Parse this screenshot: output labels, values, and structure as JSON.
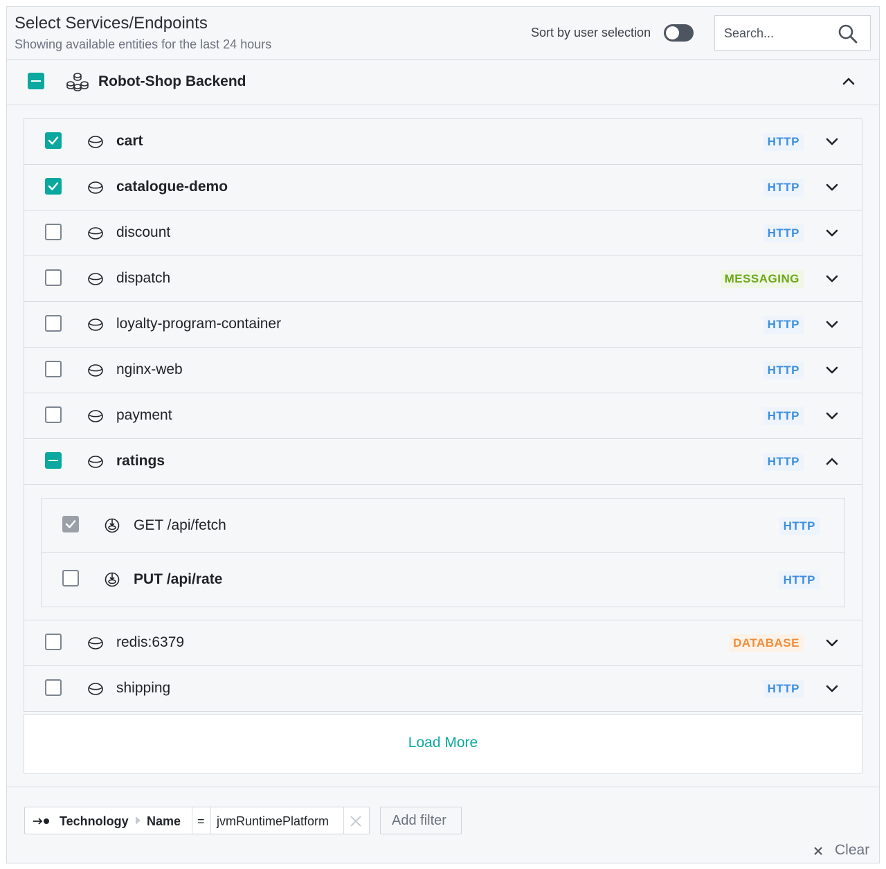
{
  "header": {
    "title": "Select Services/Endpoints",
    "subtitle": "Showing available entities for the last 24 hours",
    "sort_label": "Sort by user selection",
    "sort_toggle_on": false,
    "search_placeholder": "Search..."
  },
  "group": {
    "label": "Robot-Shop Backend",
    "checkbox": "partial",
    "expanded": true
  },
  "services": [
    {
      "name": "cart",
      "bold": true,
      "checkbox": "checked",
      "type": "HTTP",
      "expanded": false
    },
    {
      "name": "catalogue-demo",
      "bold": true,
      "checkbox": "checked",
      "type": "HTTP",
      "expanded": false
    },
    {
      "name": "discount",
      "bold": false,
      "checkbox": "unchecked",
      "type": "HTTP",
      "expanded": false
    },
    {
      "name": "dispatch",
      "bold": false,
      "checkbox": "unchecked",
      "type": "MESSAGING",
      "expanded": false
    },
    {
      "name": "loyalty-program-container",
      "bold": false,
      "checkbox": "unchecked",
      "type": "HTTP",
      "expanded": false
    },
    {
      "name": "nginx-web",
      "bold": false,
      "checkbox": "unchecked",
      "type": "HTTP",
      "expanded": false
    },
    {
      "name": "payment",
      "bold": false,
      "checkbox": "unchecked",
      "type": "HTTP",
      "expanded": false
    },
    {
      "name": "ratings",
      "bold": true,
      "checkbox": "partial",
      "type": "HTTP",
      "expanded": true
    },
    {
      "name": "redis:6379",
      "bold": false,
      "checkbox": "unchecked",
      "type": "DATABASE",
      "expanded": false
    },
    {
      "name": "shipping",
      "bold": false,
      "checkbox": "unchecked",
      "type": "HTTP",
      "expanded": false
    }
  ],
  "endpoints": [
    {
      "name": "GET /api/fetch",
      "bold": false,
      "checkbox": "disabled-checked",
      "type": "HTTP"
    },
    {
      "name": "PUT /api/rate",
      "bold": true,
      "checkbox": "unchecked",
      "type": "HTTP"
    }
  ],
  "load_more_label": "Load More",
  "filter": {
    "field": "Technology",
    "subfield": "Name",
    "operator": "=",
    "value": "jvmRuntimePlatform"
  },
  "add_filter_label": "Add filter",
  "clear_label": "Clear",
  "colors": {
    "accent": "#0aa89e",
    "http": "#3d8fe0",
    "messaging": "#6aa818",
    "database": "#f08c3a"
  }
}
